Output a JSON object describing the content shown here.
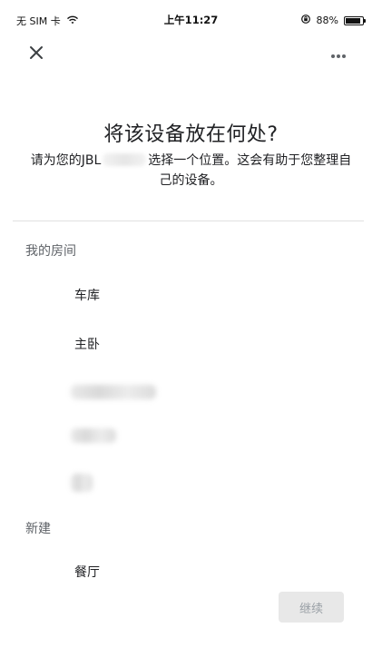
{
  "status_bar": {
    "carrier": "无 SIM 卡",
    "time": "上午11:27",
    "battery_text": "88%",
    "battery_level": 0.88
  },
  "header": {
    "title": "将该设备放在何处?",
    "subtitle_prefix": "请为您的JBL",
    "subtitle_suffix": "选择一个位置。这会有助于您整理自己的设备。"
  },
  "sections": {
    "my_rooms_label": "我的房间",
    "new_label": "新建"
  },
  "rooms": [
    {
      "label": "车库"
    },
    {
      "label": "主卧"
    }
  ],
  "new_rooms": [
    {
      "label": "餐厅"
    }
  ],
  "buttons": {
    "continue": "继续"
  },
  "icons": {
    "close": "close-icon",
    "more": "more-horizontal-icon",
    "wifi": "wifi-icon",
    "lock_rotation": "orientation-lock-icon",
    "battery": "battery-icon"
  }
}
